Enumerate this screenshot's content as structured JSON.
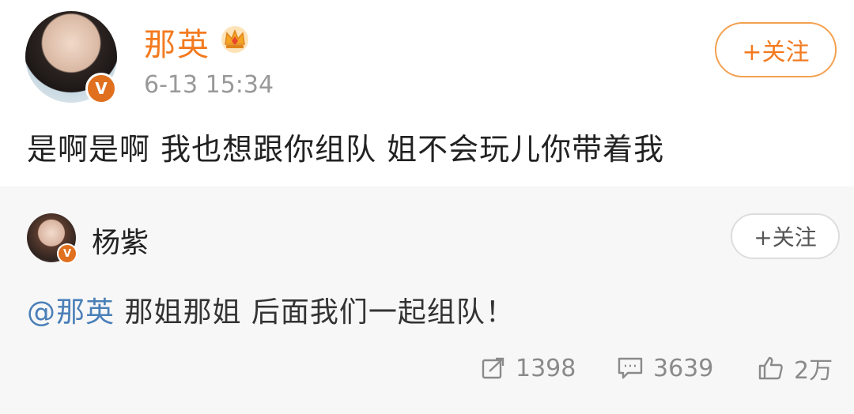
{
  "post": {
    "author": "那英",
    "timestamp": "6-13 15:34",
    "follow_label": "+关注",
    "content": "是啊是啊 我也想跟你组队 姐不会玩儿你带着我",
    "avatar_icon": "avatar-photo",
    "verified_badge": "V",
    "crown_icon": "crown-icon"
  },
  "reply": {
    "author": "杨紫",
    "follow_label": "+关注",
    "verified_badge": "V",
    "mention": "@那英",
    "text": " 那姐那姐 后面我们一起组队！"
  },
  "actions": {
    "repost_count": "1398",
    "comment_count": "3639",
    "like_count": "2万"
  },
  "colors": {
    "accent_orange": "#f37a1f",
    "mention_blue": "#4a7fb8",
    "muted_gray": "#999999",
    "reply_background": "#f7f7f7"
  }
}
